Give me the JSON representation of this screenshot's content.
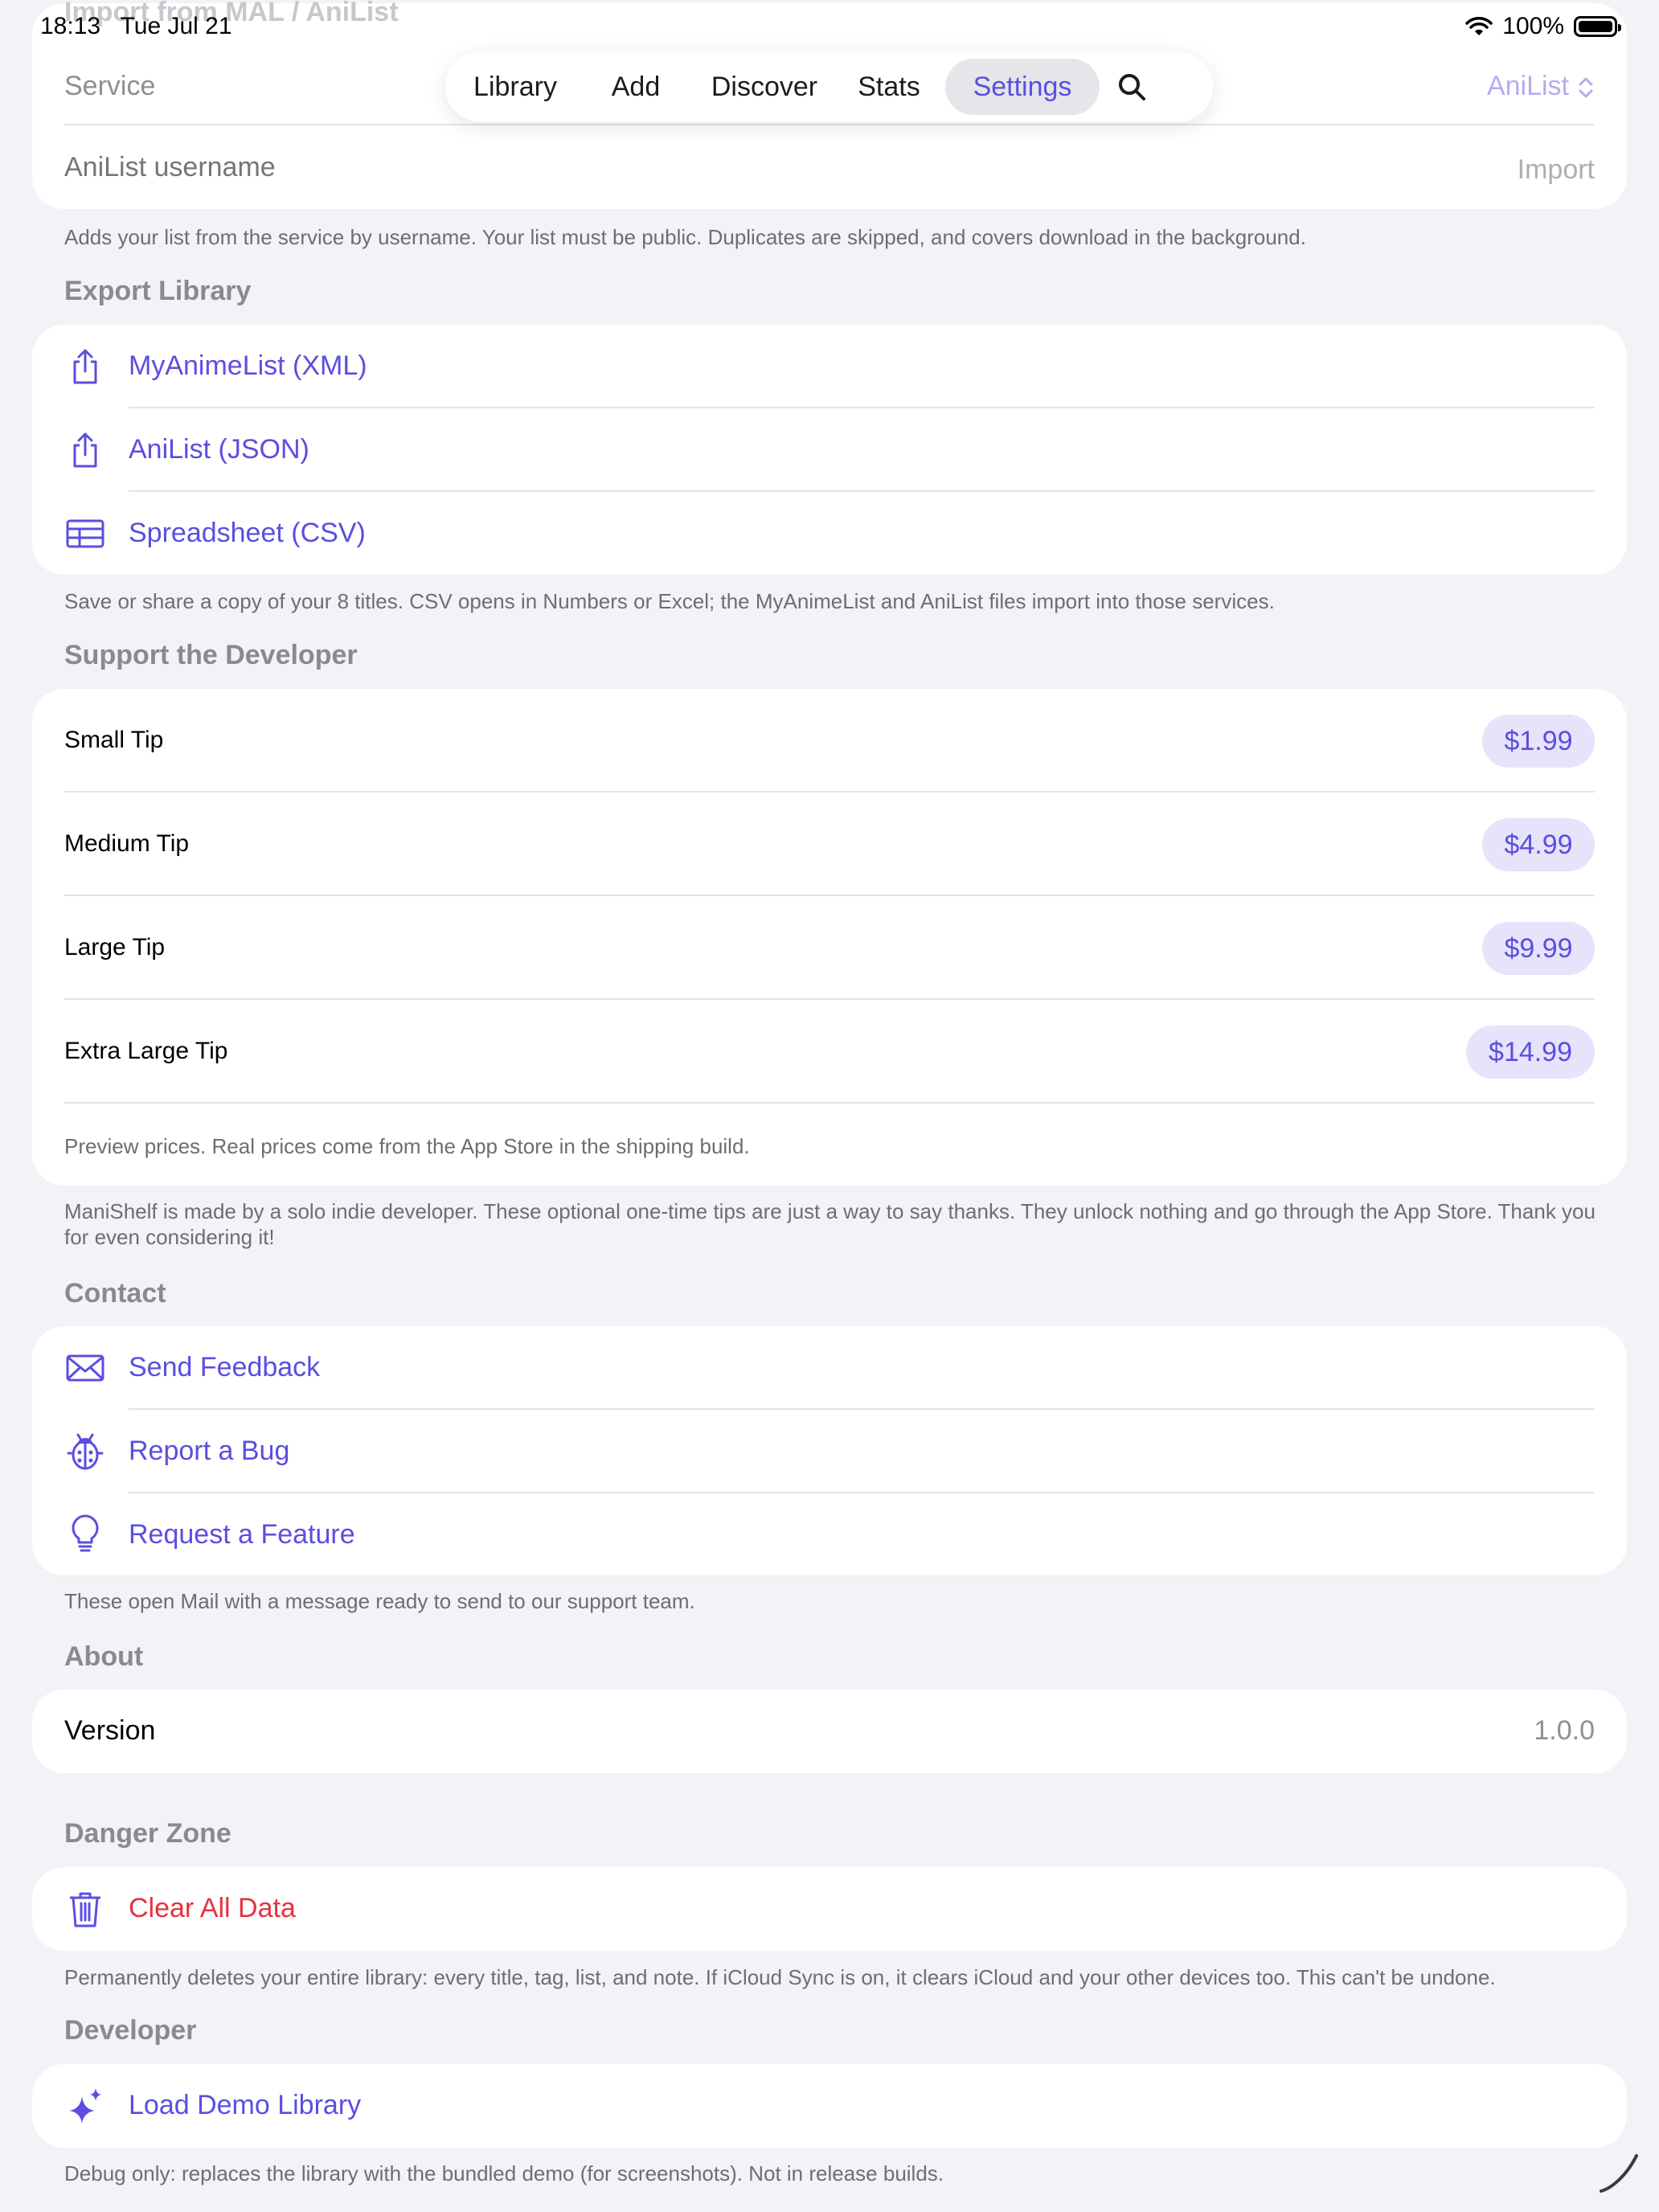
{
  "status_bar": {
    "time": "18:13",
    "date": "Tue Jul 21",
    "battery": "100%"
  },
  "ghost_header": "Import from MAL / AniList",
  "tabs": [
    {
      "label": "Library"
    },
    {
      "label": "Add"
    },
    {
      "label": "Discover"
    },
    {
      "label": "Stats"
    },
    {
      "label": "Settings"
    }
  ],
  "import": {
    "service_label": "Service",
    "service_value": "AniList",
    "username_placeholder": "AniList username",
    "import_button": "Import",
    "footnote": "Adds your list from the service by username. Your list must be public. Duplicates are skipped, and covers download in the background."
  },
  "export": {
    "title": "Export Library",
    "items": [
      {
        "label": "MyAnimeList (XML)",
        "icon": "share-icon"
      },
      {
        "label": "AniList (JSON)",
        "icon": "share-icon"
      },
      {
        "label": "Spreadsheet (CSV)",
        "icon": "table-icon"
      }
    ],
    "footnote": "Save or share a copy of your 8 titles. CSV opens in Numbers or Excel; the MyAnimeList and AniList files import into those services."
  },
  "support": {
    "title": "Support the Developer",
    "tips": [
      {
        "label": "Small Tip",
        "price": "$1.99"
      },
      {
        "label": "Medium Tip",
        "price": "$4.99"
      },
      {
        "label": "Large Tip",
        "price": "$9.99"
      },
      {
        "label": "Extra Large Tip",
        "price": "$14.99"
      }
    ],
    "preview_note": "Preview prices. Real prices come from the App Store in the shipping build.",
    "footnote": "ManiShelf is made by a solo indie developer. These optional one-time tips are just a way to say thanks. They unlock nothing and go through the App Store. Thank you for even considering it!"
  },
  "contact": {
    "title": "Contact",
    "items": [
      {
        "label": "Send Feedback",
        "icon": "envelope-icon"
      },
      {
        "label": "Report a Bug",
        "icon": "ladybug-icon"
      },
      {
        "label": "Request a Feature",
        "icon": "lightbulb-icon"
      }
    ],
    "footnote": "These open Mail with a message ready to send to our support team."
  },
  "about": {
    "title": "About",
    "version_label": "Version",
    "version_value": "1.0.0"
  },
  "danger": {
    "title": "Danger Zone",
    "clear_label": "Clear All Data",
    "footnote": "Permanently deletes your entire library: every title, tag, list, and note. If iCloud Sync is on, it clears iCloud and your other devices too. This can't be undone."
  },
  "developer": {
    "title": "Developer",
    "demo_label": "Load Demo Library",
    "footnote": "Debug only: replaces the library with the bundled demo (for screenshots). Not in release builds."
  },
  "colors": {
    "accent": "#5b4ee0",
    "danger": "#e5333d",
    "background": "#f2f2f7"
  }
}
